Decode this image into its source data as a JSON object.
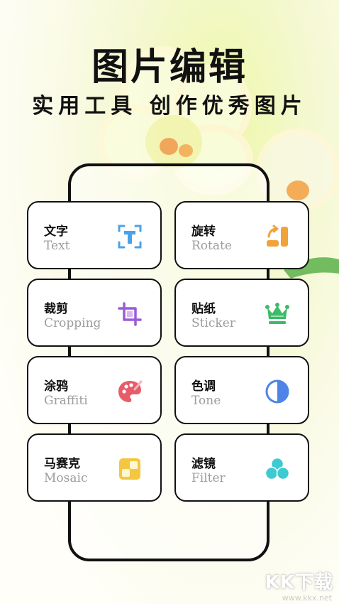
{
  "header": {
    "title": "图片编辑",
    "subtitle": "实用工具 创作优秀图片"
  },
  "tools": [
    {
      "cn": "文字",
      "en": "Text",
      "icon": "text-icon",
      "color": "#4aa3e8"
    },
    {
      "cn": "旋转",
      "en": "Rotate",
      "icon": "rotate-icon",
      "color": "#f0a33a"
    },
    {
      "cn": "裁剪",
      "en": "Cropping",
      "icon": "crop-icon",
      "color": "#9b5bd6"
    },
    {
      "cn": "贴纸",
      "en": "Sticker",
      "icon": "crown-icon",
      "color": "#3dba6a"
    },
    {
      "cn": "涂鸦",
      "en": "Graffiti",
      "icon": "palette-icon",
      "color": "#e85c6a"
    },
    {
      "cn": "色调",
      "en": "Tone",
      "icon": "tone-icon",
      "color": "#4f83e8"
    },
    {
      "cn": "马赛克",
      "en": "Mosaic",
      "icon": "mosaic-icon",
      "color": "#f3c740"
    },
    {
      "cn": "滤镜",
      "en": "Filter",
      "icon": "filter-icon",
      "color": "#3ccbd0"
    }
  ],
  "watermark": {
    "text": "KK下载",
    "url": "www.kkx.net"
  }
}
